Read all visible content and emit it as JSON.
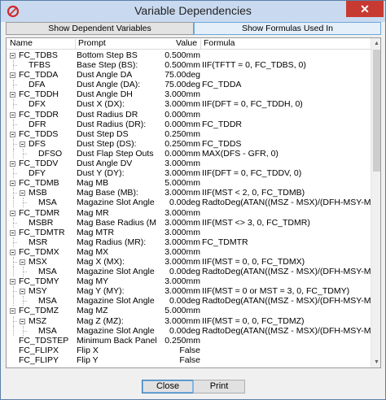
{
  "window": {
    "title": "Variable Dependencies",
    "close_glyph": "✕"
  },
  "tabs": [
    {
      "label": "Show Dependent Variables"
    },
    {
      "label": "Show Formulas Used In"
    }
  ],
  "columns": {
    "name": "Name",
    "prompt": "Prompt",
    "value": "Value",
    "formula": "Formula"
  },
  "rows": [
    {
      "level": 0,
      "name": "FC_TDBS",
      "prompt": "Bottom Step BS",
      "value": "0.500mm",
      "formula": "",
      "expander": true
    },
    {
      "level": 1,
      "name": "TFBS",
      "prompt": "Base Step (BS):",
      "value": "0.500mm",
      "formula": "IIF(TFTT = 0, FC_TDBS, 0)"
    },
    {
      "level": 0,
      "name": "FC_TDDA",
      "prompt": "Dust Angle DA",
      "value": "75.00deg",
      "formula": "",
      "expander": true
    },
    {
      "level": 1,
      "name": "DFA",
      "prompt": "Dust Angle (DA):",
      "value": "75.00deg",
      "formula": "FC_TDDA"
    },
    {
      "level": 0,
      "name": "FC_TDDH",
      "prompt": "Dust Angle DH",
      "value": "3.000mm",
      "formula": "",
      "expander": true
    },
    {
      "level": 1,
      "name": "DFX",
      "prompt": "Dust X (DX):",
      "value": "3.000mm",
      "formula": "IIF(DFT = 0, FC_TDDH, 0)"
    },
    {
      "level": 0,
      "name": "FC_TDDR",
      "prompt": "Dust Radius DR",
      "value": "0.000mm",
      "formula": "",
      "expander": true
    },
    {
      "level": 1,
      "name": "DFR",
      "prompt": "Dust Radius (DR):",
      "value": "0.000mm",
      "formula": "FC_TDDR"
    },
    {
      "level": 0,
      "name": "FC_TDDS",
      "prompt": "Dust Step DS",
      "value": "0.250mm",
      "formula": "",
      "expander": true
    },
    {
      "level": 1,
      "name": "DFS",
      "prompt": "Dust Step (DS):",
      "value": "0.250mm",
      "formula": "FC_TDDS",
      "expander": true
    },
    {
      "level": 2,
      "name": "DFSO",
      "prompt": "Dust Flap Step Outs",
      "value": "0.000mm",
      "formula": "MAX(DFS - GFR, 0)"
    },
    {
      "level": 0,
      "name": "FC_TDDV",
      "prompt": "Dust Angle DV",
      "value": "3.000mm",
      "formula": "",
      "expander": true
    },
    {
      "level": 1,
      "name": "DFY",
      "prompt": "Dust Y (DY):",
      "value": "3.000mm",
      "formula": "IIF(DFT = 0, FC_TDDV, 0)"
    },
    {
      "level": 0,
      "name": "FC_TDMB",
      "prompt": "Mag MB",
      "value": "5.000mm",
      "formula": "",
      "expander": true
    },
    {
      "level": 1,
      "name": "MSB",
      "prompt": "Mag Base (MB):",
      "value": "3.000mm",
      "formula": "IIF(MST < 2, 0, FC_TDMB)",
      "expander": true
    },
    {
      "level": 2,
      "name": "MSA",
      "prompt": "Magazine Slot Angle",
      "value": "0.00deg",
      "formula": "RadtoDeg(ATAN((MSZ - MSX)/(DFH-MSY-MSB)))"
    },
    {
      "level": 0,
      "name": "FC_TDMR",
      "prompt": "Mag MR",
      "value": "3.000mm",
      "formula": "",
      "expander": true
    },
    {
      "level": 1,
      "name": "MSBR",
      "prompt": "Mag Base Radius (M",
      "value": "3.000mm",
      "formula": "IIF(MST <> 3, 0, FC_TDMR)"
    },
    {
      "level": 0,
      "name": "FC_TDMTR",
      "prompt": "Mag MTR",
      "value": "3.000mm",
      "formula": "",
      "expander": true
    },
    {
      "level": 1,
      "name": "MSR",
      "prompt": "Mag Radius (MR):",
      "value": "3.000mm",
      "formula": "FC_TDMTR"
    },
    {
      "level": 0,
      "name": "FC_TDMX",
      "prompt": "Mag MX",
      "value": "3.000mm",
      "formula": "",
      "expander": true
    },
    {
      "level": 1,
      "name": "MSX",
      "prompt": "Mag X (MX):",
      "value": "3.000mm",
      "formula": "IIF(MST = 0, 0, FC_TDMX)",
      "expander": true
    },
    {
      "level": 2,
      "name": "MSA",
      "prompt": "Magazine Slot Angle",
      "value": "0.00deg",
      "formula": "RadtoDeg(ATAN((MSZ - MSX)/(DFH-MSY-MSB)))"
    },
    {
      "level": 0,
      "name": "FC_TDMY",
      "prompt": "Mag MY",
      "value": "3.000mm",
      "formula": "",
      "expander": true
    },
    {
      "level": 1,
      "name": "MSY",
      "prompt": "Mag Y (MY):",
      "value": "3.000mm",
      "formula": "IIF(MST = 0 or MST = 3, 0, FC_TDMY)",
      "expander": true
    },
    {
      "level": 2,
      "name": "MSA",
      "prompt": "Magazine Slot Angle",
      "value": "0.00deg",
      "formula": "RadtoDeg(ATAN((MSZ - MSX)/(DFH-MSY-MSB)))"
    },
    {
      "level": 0,
      "name": "FC_TDMZ",
      "prompt": "Mag MZ",
      "value": "5.000mm",
      "formula": "",
      "expander": true
    },
    {
      "level": 1,
      "name": "MSZ",
      "prompt": "Mag Z (MZ):",
      "value": "3.000mm",
      "formula": "IIF(MST = 0, 0, FC_TDMZ)",
      "expander": true
    },
    {
      "level": 2,
      "name": "MSA",
      "prompt": "Magazine Slot Angle",
      "value": "0.00deg",
      "formula": "RadtoDeg(ATAN((MSZ - MSX)/(DFH-MSY-MSB)))"
    },
    {
      "level": 0,
      "name": "FC_TDSTEP",
      "prompt": "Minimum Back Panel",
      "value": "0.250mm",
      "formula": ""
    },
    {
      "level": 0,
      "name": "FC_FLIPX",
      "prompt": "Flip X",
      "value": "False",
      "formula": ""
    },
    {
      "level": 0,
      "name": "FC_FLIPY",
      "prompt": "Flip Y",
      "value": "False",
      "formula": ""
    }
  ],
  "buttons": {
    "close": "Close",
    "print": "Print"
  }
}
